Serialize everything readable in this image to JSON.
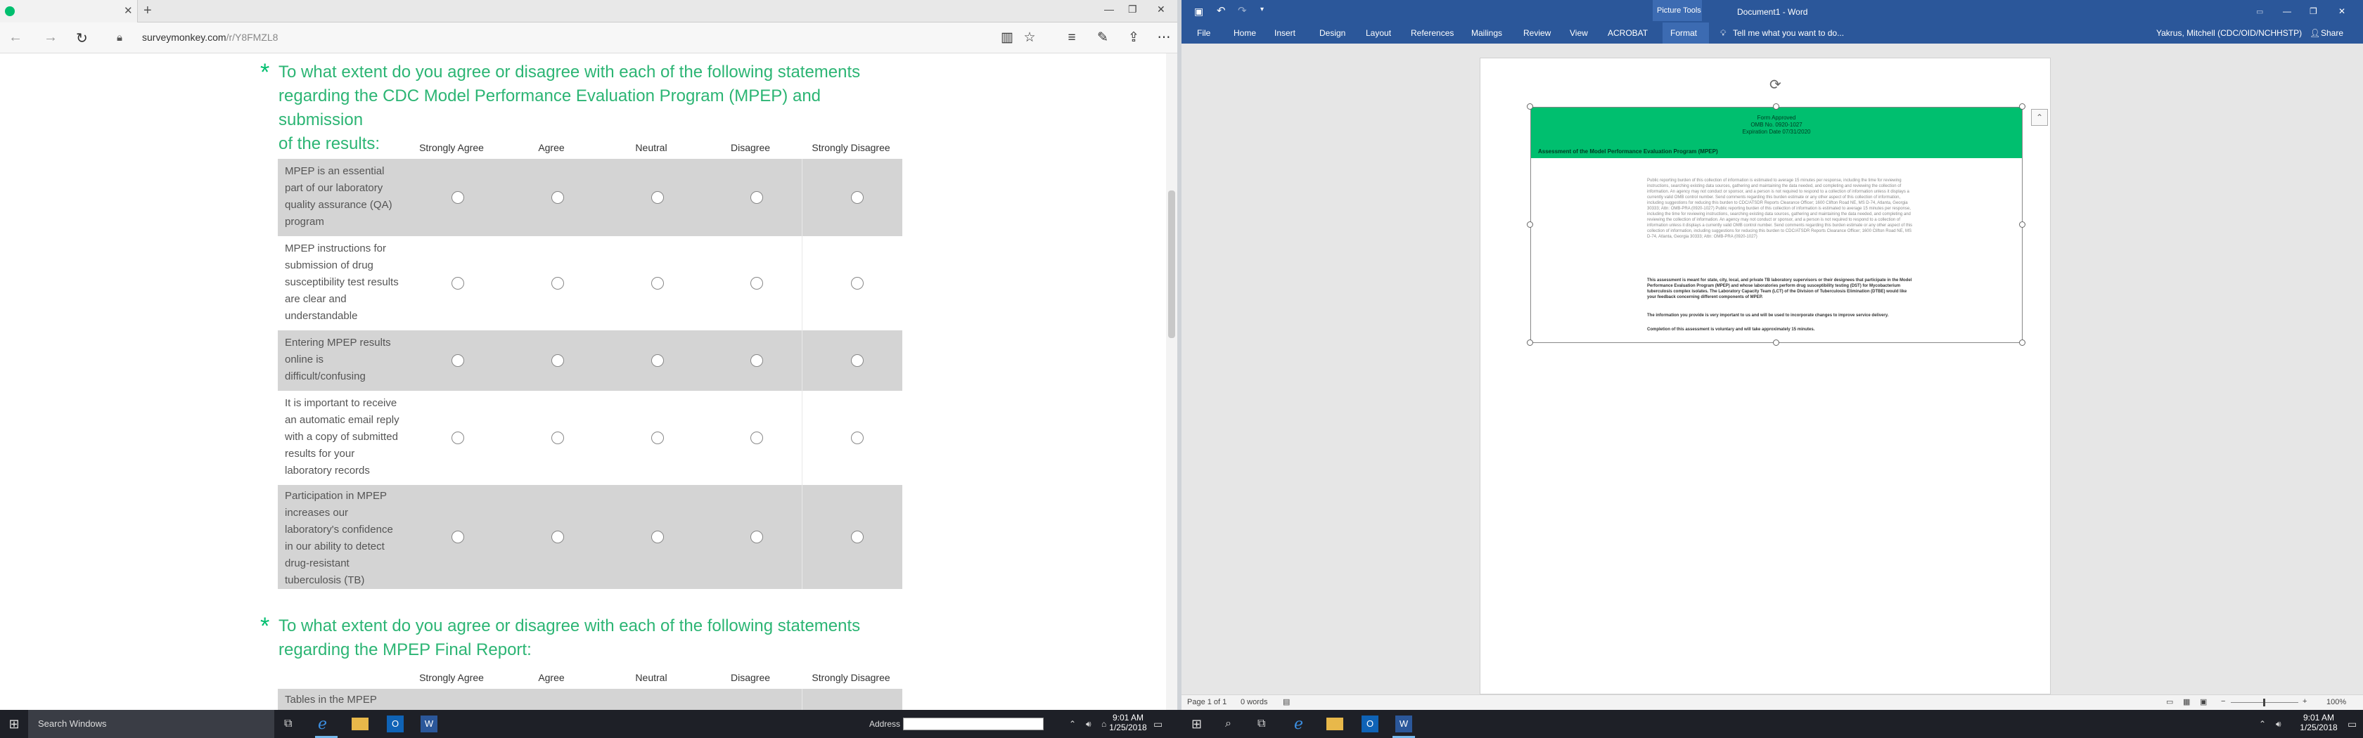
{
  "browser": {
    "url_domain": "surveymonkey.com",
    "url_path": "/r/Y8FMZL8",
    "icons": [
      "back-icon",
      "forward-icon",
      "refresh-icon",
      "lock-icon",
      "reading-view-icon",
      "favorites-star-icon",
      "hub-icon",
      "web-note-icon",
      "share-icon",
      "more-icon"
    ]
  },
  "survey": {
    "q1": {
      "line1": "To what extent do you agree or disagree with each of the following statements",
      "line2": "regarding the CDC Model Performance Evaluation Program (MPEP) and submission",
      "line3": "of the results:"
    },
    "columns": [
      "Strongly Agree",
      "Agree",
      "Neutral",
      "Disagree",
      "Strongly Disagree"
    ],
    "rows": [
      {
        "label": "MPEP is an essential part of our laboratory quality assurance (QA) program"
      },
      {
        "label": "MPEP instructions for submission of drug susceptibility test results are clear and understandable"
      },
      {
        "label": "Entering MPEP results online is difficult/confusing"
      },
      {
        "label": "It is important to receive an automatic email reply with a copy of submitted results for your laboratory records"
      },
      {
        "label": "Participation in MPEP increases our laboratory's confidence in our ability to detect drug-resistant tuberculosis (TB)"
      }
    ],
    "q2": {
      "line1": "To what extent do you agree or disagree with each of the following statements",
      "line2": "regarding the MPEP Final Report:"
    },
    "q2_first_row": "Tables in the MPEP"
  },
  "word": {
    "picture_tools": "Picture Tools",
    "doc_title": "Document1 - Word",
    "tell_me": "Tell me what you want to do...",
    "user": "Yakrus, Mitchell (CDC/OID/NCHHSTP)",
    "share": "Share",
    "tabs": [
      "File",
      "Home",
      "Insert",
      "Design",
      "Layout",
      "References",
      "Mailings",
      "Review",
      "View",
      "ACROBAT",
      "Format"
    ],
    "image": {
      "line1": "Form Approved",
      "line2": "OMB No. 0920-1027",
      "line3": "Expiration Date 07/31/2020",
      "title": "Assessment of the Model Performance Evaluation Program (MPEP)",
      "burden": "Public reporting burden of this collection of information is estimated to average 15 minutes per response, including the time for reviewing instructions, searching existing data sources, gathering and maintaining the data needed, and completing and reviewing the collection of information. An agency may not conduct or sponsor, and a person is not required to respond to a collection of information unless it displays a currently valid OMB control number. Send comments regarding this burden estimate or any other aspect of this collection of information, including suggestions for reducing this burden to CDC/ATSDR Reports Clearance Officer; 1600 Clifton Road NE, MS D-74, Atlanta, Georgia 30333; Attn: OMB-PRA (0920-1027) Public reporting burden of this collection of information is estimated to average 15 minutes per response, including the time for reviewing instructions, searching existing data sources, gathering and maintaining the data needed, and completing and reviewing the collection of information. An agency may not conduct or sponsor, and a person is not required to respond to a collection of information unless it displays a currently valid OMB control number. Send comments regarding this burden estimate or any other aspect of this collection of information, including suggestions for reducing this burden to CDC/ATSDR Reports Clearance Officer; 1600 Clifton Road NE, MS D-74, Atlanta, Georgia 30333; Attn: OMB-PRA (0920-1027)",
      "assess": "This assessment is meant for state, city, local, and private TB laboratory supervisors or their designees that participate in the Model Performance Evaluation Program (MPEP) and whose laboratories perform drug susceptibility testing (DST) for Mycobacterium tuberculosis complex isolates. The Laboratory Capacity Team (LCT) of the Division of Tuberculosis Elimination (DTBE) would like your feedback concerning different components of MPEP.",
      "info": "The information you provide is very important to us and will be used to incorporate changes to improve service delivery.",
      "voluntary": "Completion of this assessment is voluntary and will take approximately 15 minutes."
    },
    "status_page": "Page 1 of 1",
    "status_words": "0 words",
    "zoom": "100%"
  },
  "taskbar": {
    "search": "Search Windows",
    "address_label": "Address",
    "time_left": "9:01 AM",
    "date_left": "1/25/2018",
    "time_right": "9:01 AM",
    "date_right": "1/25/2018"
  },
  "colors": {
    "survey_green": "#00bf6f",
    "word_blue": "#2b579a",
    "taskbar": "#1e2027"
  }
}
